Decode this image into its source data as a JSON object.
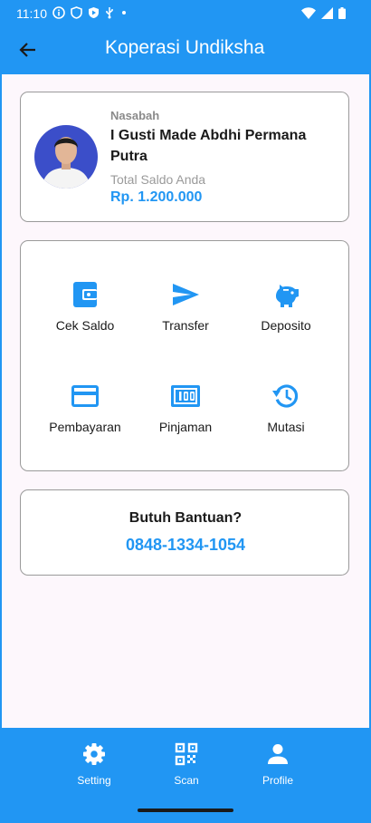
{
  "status_bar": {
    "time": "11:10"
  },
  "app_bar": {
    "title": "Koperasi Undiksha"
  },
  "profile": {
    "label": "Nasabah",
    "name": "I Gusti Made Abdhi Permana Putra",
    "saldo_label": "Total Saldo Anda",
    "saldo_value": "Rp. 1.200.000"
  },
  "menu": {
    "items": [
      {
        "label": "Cek Saldo",
        "icon": "wallet-icon"
      },
      {
        "label": "Transfer",
        "icon": "send-icon"
      },
      {
        "label": "Deposito",
        "icon": "piggy-bank-icon"
      },
      {
        "label": "Pembayaran",
        "icon": "credit-card-icon"
      },
      {
        "label": "Pinjaman",
        "icon": "money-bill-icon"
      },
      {
        "label": "Mutasi",
        "icon": "history-icon"
      }
    ]
  },
  "help": {
    "title": "Butuh Bantuan?",
    "phone": "0848-1334-1054"
  },
  "bottom_nav": {
    "items": [
      {
        "label": "Setting",
        "icon": "gear-icon"
      },
      {
        "label": "Scan",
        "icon": "qr-code-icon"
      },
      {
        "label": "Profile",
        "icon": "person-icon"
      }
    ]
  },
  "colors": {
    "primary": "#2196F3",
    "background": "#FDF7FC",
    "card_border": "#9a9a9a"
  }
}
